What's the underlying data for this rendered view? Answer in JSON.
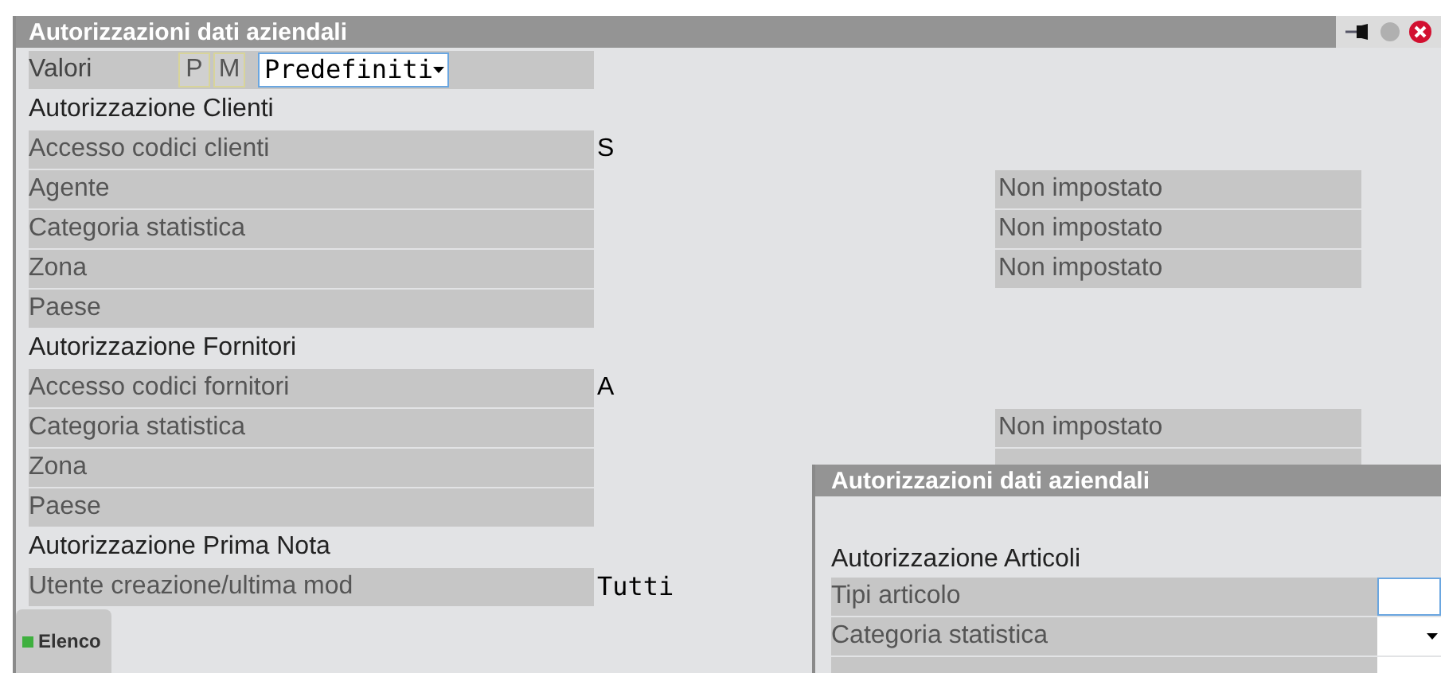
{
  "window": {
    "title": "Autorizzazioni dati aziendali"
  },
  "valori": {
    "label": "Valori",
    "buttons": [
      "P",
      "M"
    ],
    "value": "Predefiniti"
  },
  "rows": [
    {
      "kind": "section",
      "label": "Autorizzazione Clienti"
    },
    {
      "kind": "field",
      "label": "Accesso codici clienti",
      "value": "S"
    },
    {
      "kind": "field",
      "label": "Agente",
      "right_cell": true,
      "right": "Non impostato"
    },
    {
      "kind": "field",
      "label": "Categoria statistica",
      "right_cell": true,
      "right": "Non impostato"
    },
    {
      "kind": "field",
      "label": "Zona",
      "right_cell": true,
      "right": "Non impostato"
    },
    {
      "kind": "field",
      "label": "Paese"
    },
    {
      "kind": "section",
      "label": "Autorizzazione Fornitori"
    },
    {
      "kind": "field",
      "label": "Accesso codici fornitori",
      "value": "A"
    },
    {
      "kind": "field",
      "label": "Categoria statistica",
      "right_cell": true,
      "right": "Non impostato"
    },
    {
      "kind": "field",
      "label": "Zona",
      "right_cell": true
    },
    {
      "kind": "field",
      "label": "Paese"
    },
    {
      "kind": "section",
      "label": "Autorizzazione Prima Nota"
    },
    {
      "kind": "field",
      "label": "Utente creazione/ultima mod",
      "value": "Tutti",
      "mono": true
    }
  ],
  "button": {
    "label": "Elenco"
  },
  "dialog": {
    "title": "Autorizzazioni dati aziendali",
    "section": "Autorizzazione Articoli",
    "rows": [
      {
        "kind": "input",
        "label": "Tipi articolo",
        "focused": true
      },
      {
        "kind": "select",
        "label": "Categoria statistica",
        "focused": false
      },
      {
        "kind": "input",
        "focused": false
      }
    ]
  }
}
